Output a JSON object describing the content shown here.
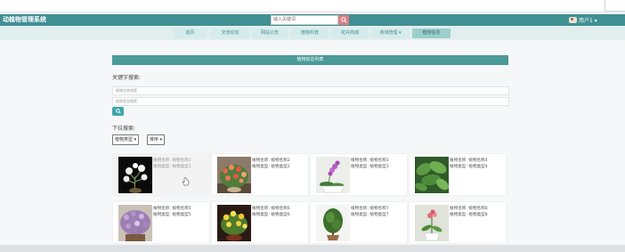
{
  "header": {
    "brand": "动植物管理系统",
    "search_placeholder": "输入关键词",
    "user_label": "用户1 ▾"
  },
  "nav": {
    "items": [
      {
        "label": "首页"
      },
      {
        "label": "交流论坛"
      },
      {
        "label": "网站公告"
      },
      {
        "label": "植物科普"
      },
      {
        "label": "花卉商城"
      },
      {
        "label": "商城管理 ▾"
      },
      {
        "label": "植物信息"
      }
    ]
  },
  "list": {
    "title": "植物信息列表",
    "keyword_label": "关键字搜索:",
    "name_placeholder": "植物名称搜索",
    "type_placeholder": "植物类型搜索",
    "dropdown_label": "下拉搜索:",
    "type_dropdown": "植物类型 ▾",
    "sort_dropdown": "排序 ▾"
  },
  "plants": [
    {
      "name": "植物名称: 植物名称1",
      "type": "植物类型: 植物类型1"
    },
    {
      "name": "植物名称: 植物名称2",
      "type": "植物类型: 植物类型2"
    },
    {
      "name": "植物名称: 植物名称3",
      "type": "植物类型: 植物类型3"
    },
    {
      "name": "植物名称: 植物名称4",
      "type": "植物类型: 植物类型4"
    },
    {
      "name": "植物名称: 植物名称5",
      "type": "植物类型: 植物类型5"
    },
    {
      "name": "植物名称: 植物名称6",
      "type": "植物类型: 植物类型6"
    },
    {
      "name": "植物名称: 植物名称7",
      "type": "植物类型: 植物类型7"
    },
    {
      "name": "植物名称: 植物名称8",
      "type": "植物类型: 植物类型8"
    }
  ],
  "colors": {
    "header": "#3f8f93",
    "section_bar": "#4a9a98",
    "search_button": "#d97f87",
    "nav_active": "#9ccfcb"
  }
}
